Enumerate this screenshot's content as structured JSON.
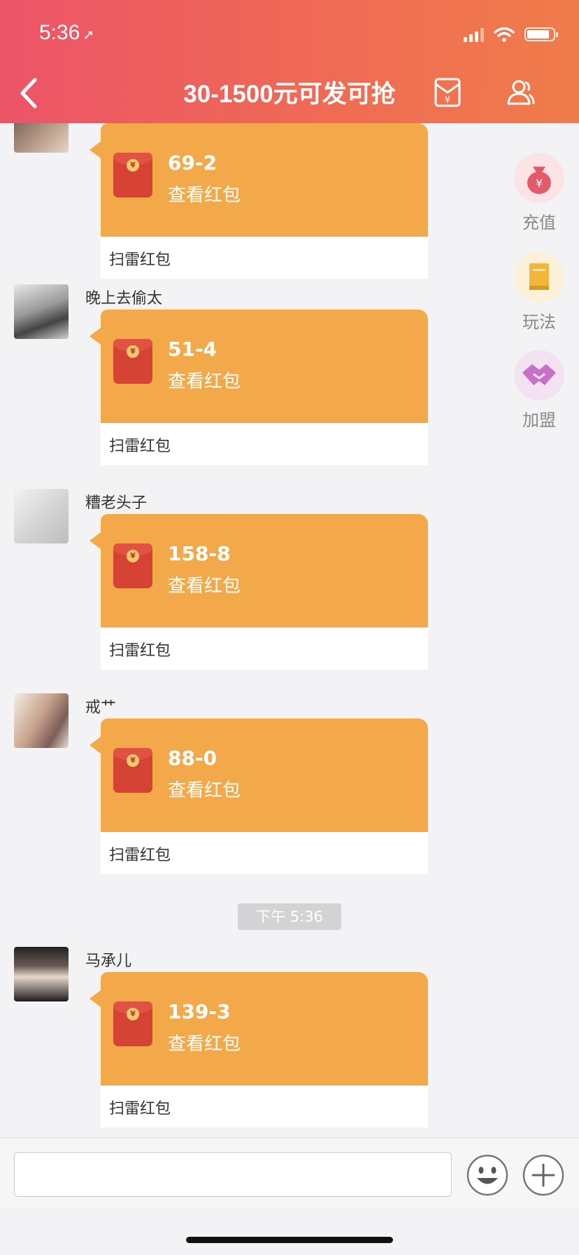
{
  "status_bar": {
    "time": "5:36",
    "location_arrow": "location-arrow-icon",
    "battery_level": 0.85
  },
  "header": {
    "title": "30-1500元可发可抢",
    "back_icon": "back-chevron-icon",
    "envelope_icon": "red-packet-icon",
    "members_icon": "group-members-icon"
  },
  "colors": {
    "header_start": "#ec5468",
    "header_end": "#f07c4a",
    "bubble": "#f3a94a",
    "envelope": "#d64233"
  },
  "side_menu": [
    {
      "label": "充值",
      "icon": "money-bag-icon"
    },
    {
      "label": "玩法",
      "icon": "book-icon"
    },
    {
      "label": "加盟",
      "icon": "handshake-icon"
    }
  ],
  "messages": [
    {
      "sender": "",
      "amount": "69-2",
      "action": "查看红包",
      "footer": "扫雷红包"
    },
    {
      "sender": "晚上去偷太",
      "amount": "51-4",
      "action": "查看红包",
      "footer": "扫雷红包"
    },
    {
      "sender": "糟老头子",
      "amount": "158-8",
      "action": "查看红包",
      "footer": "扫雷红包"
    },
    {
      "sender": "戒艹",
      "amount": "88-0",
      "action": "查看红包",
      "footer": "扫雷红包"
    },
    {
      "sender": "马承儿",
      "amount": "139-3",
      "action": "查看红包",
      "footer": "扫雷红包"
    }
  ],
  "timestamp": "下午 5:36",
  "input": {
    "value": "",
    "placeholder": ""
  }
}
